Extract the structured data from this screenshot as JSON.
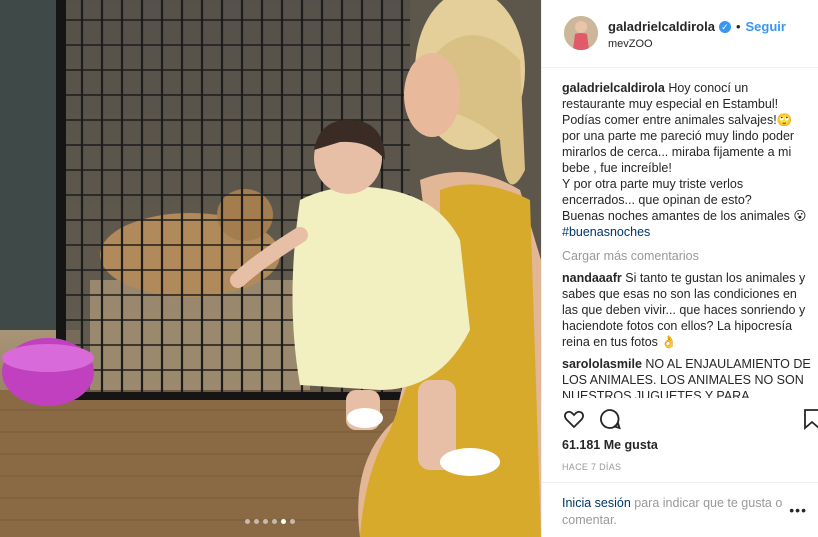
{
  "post": {
    "username": "galadrielcaldirola",
    "separator": "•",
    "follow_label": "Seguir",
    "location": "mevZOO",
    "caption": {
      "user": "galadrielcaldirola",
      "text": "Hoy conocí un restaurante muy especial en Estambul! Podías comer entre animales salvajes!🙄 por una parte me pareció muy lindo poder mirarlos de cerca... miraba fijamente a mi bebe , fue increíble!\nY por otra parte muy triste verlos encerrados... que opinan de esto?\nBuenas noches amantes de los animales 😮",
      "hashtag": "#buenasnoches"
    },
    "load_more_label": "Cargar más comentarios",
    "comments": [
      {
        "user": "nandaaafr",
        "text": "Si tanto te gustan los animales y sabes que esas no son las condiciones en las que deben vivir... que haces sonriendo y haciendote fotos con ellos? La hipocresía reina en tus fotos 👌"
      },
      {
        "user": "sarololasmile",
        "text": "NO AL ENJAULAMIENTO DE LOS ANIMALES. LOS ANIMALES NO SON NUESTROS JUGUETES Y PARA NUESTRA"
      }
    ],
    "likes": "61.181 Me gusta",
    "time": "HACE 7 DÍAS",
    "login_link": "Inicia sesión",
    "login_text": "para indicar que te gusta o comentar.",
    "more_label": "•••"
  },
  "carousel": {
    "count": 6,
    "active_index": 4
  },
  "icons": [
    "verified-badge-icon",
    "heart-icon",
    "comment-icon",
    "bookmark-icon",
    "more-options-icon"
  ],
  "colors": {
    "link": "#3897f0",
    "hashtag": "#003569",
    "muted": "#999999",
    "text": "#262626"
  }
}
